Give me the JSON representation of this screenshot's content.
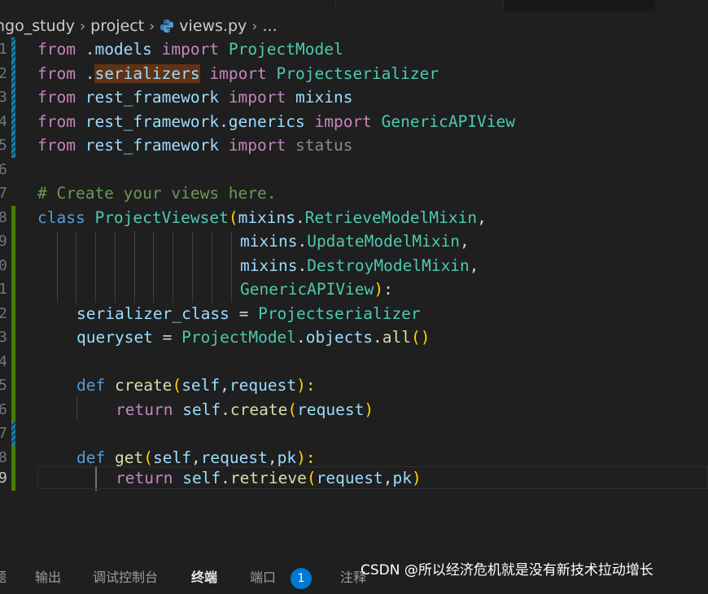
{
  "breadcrumb": {
    "folder1": "ngo_study",
    "folder2": "project",
    "file": "views.py",
    "more": "..."
  },
  "icons": {
    "separator": "chevron-right-icon",
    "file": "python-icon"
  },
  "colors": {
    "keyword": "#c586c0",
    "def": "#569cd6",
    "function": "#dcdcaa",
    "class": "#4ec9b0",
    "variable": "#9cdcfe",
    "comment": "#6a9955",
    "modified_gutter": "#1b81a8",
    "added_gutter": "#487e02"
  },
  "editor": {
    "line_numbers": [
      "1",
      "2",
      "3",
      "4",
      "5",
      "6",
      "7",
      "8",
      "9",
      "0",
      "1",
      "2",
      "3",
      "4",
      "5",
      "6",
      "7",
      "8",
      "9"
    ],
    "lines": {
      "l1": [
        "from",
        " .models ",
        "import",
        " ProjectModel"
      ],
      "l2": [
        "from",
        " .",
        "serializers",
        " ",
        "import",
        " Projectserializer"
      ],
      "l3": [
        "from",
        " rest_framework ",
        "import",
        " mixins"
      ],
      "l4": [
        "from",
        " rest_framework.generics ",
        "import",
        " GenericAPIView"
      ],
      "l5": [
        "from",
        " rest_framework ",
        "import",
        " status"
      ],
      "l7": [
        "# Create your views here."
      ],
      "l8": [
        "class",
        " ",
        "ProjectViewset",
        "(",
        "mixins",
        ".",
        "RetrieveModelMixin",
        ","
      ],
      "l9": [
        "mixins",
        ".",
        "UpdateModelMixin",
        ","
      ],
      "l10": [
        "mixins",
        ".",
        "DestroyModelMixin",
        ","
      ],
      "l11": [
        "GenericAPIView",
        ")",
        ":"
      ],
      "l12": [
        "serializer_class",
        " = ",
        "Projectserializer"
      ],
      "l13": [
        "queryset",
        " = ",
        "ProjectModel",
        ".",
        "objects",
        ".",
        "all",
        "()"
      ],
      "l15": [
        "def",
        " ",
        "create",
        "(",
        "self",
        ",",
        "request",
        "):"
      ],
      "l16": [
        "return",
        " ",
        "self",
        ".",
        "create",
        "(",
        "request",
        ")"
      ],
      "l18": [
        "def",
        " ",
        "get",
        "(",
        "self",
        ",",
        "request",
        ",",
        "pk",
        "):"
      ],
      "l19": [
        "return",
        " ",
        "self",
        ".",
        "retrieve",
        "(",
        "request",
        ",",
        "pk",
        ")"
      ]
    }
  },
  "panel": {
    "tabs": [
      "题",
      "输出",
      "调试控制台",
      "终端",
      "端口",
      "注释"
    ],
    "ports_badge": "1"
  },
  "watermark": "CSDN @所以经济危机就是没有新技术拉动增长"
}
